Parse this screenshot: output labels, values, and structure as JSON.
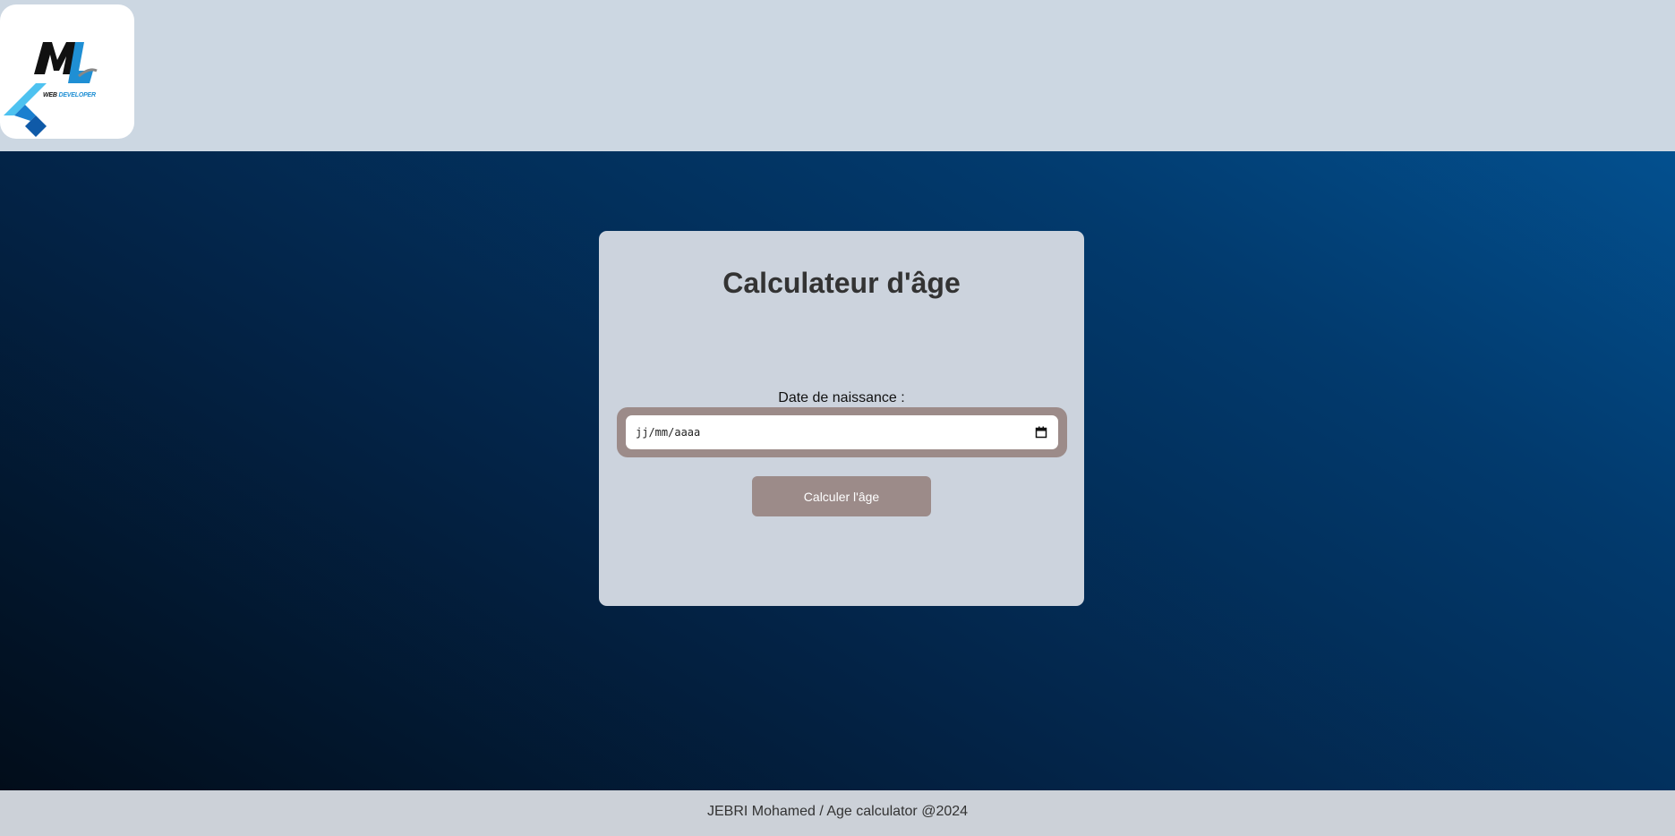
{
  "header": {
    "logo": {
      "icon": "ml-web-developer-logo",
      "caption_part1": "WEB",
      "caption_part2": "DEVELOPER",
      "colors": {
        "black": "#111111",
        "blue": "#1f8fd4",
        "light_blue": "#4ec2f0"
      }
    }
  },
  "card": {
    "title": "Calculateur d'âge",
    "birthdate_label": "Date de naissance :",
    "date_placeholder": "jj/mm/aaaa",
    "button_label": "Calculer l'âge"
  },
  "footer": {
    "text": "JEBRI Mohamed / Age calculator @2024"
  },
  "colors": {
    "header_bg": "#ccd7e2",
    "card_bg": "#ccd3dd",
    "accent": "#9c8b89",
    "gradient_dark": "#020d1a",
    "gradient_light": "#03508f"
  }
}
